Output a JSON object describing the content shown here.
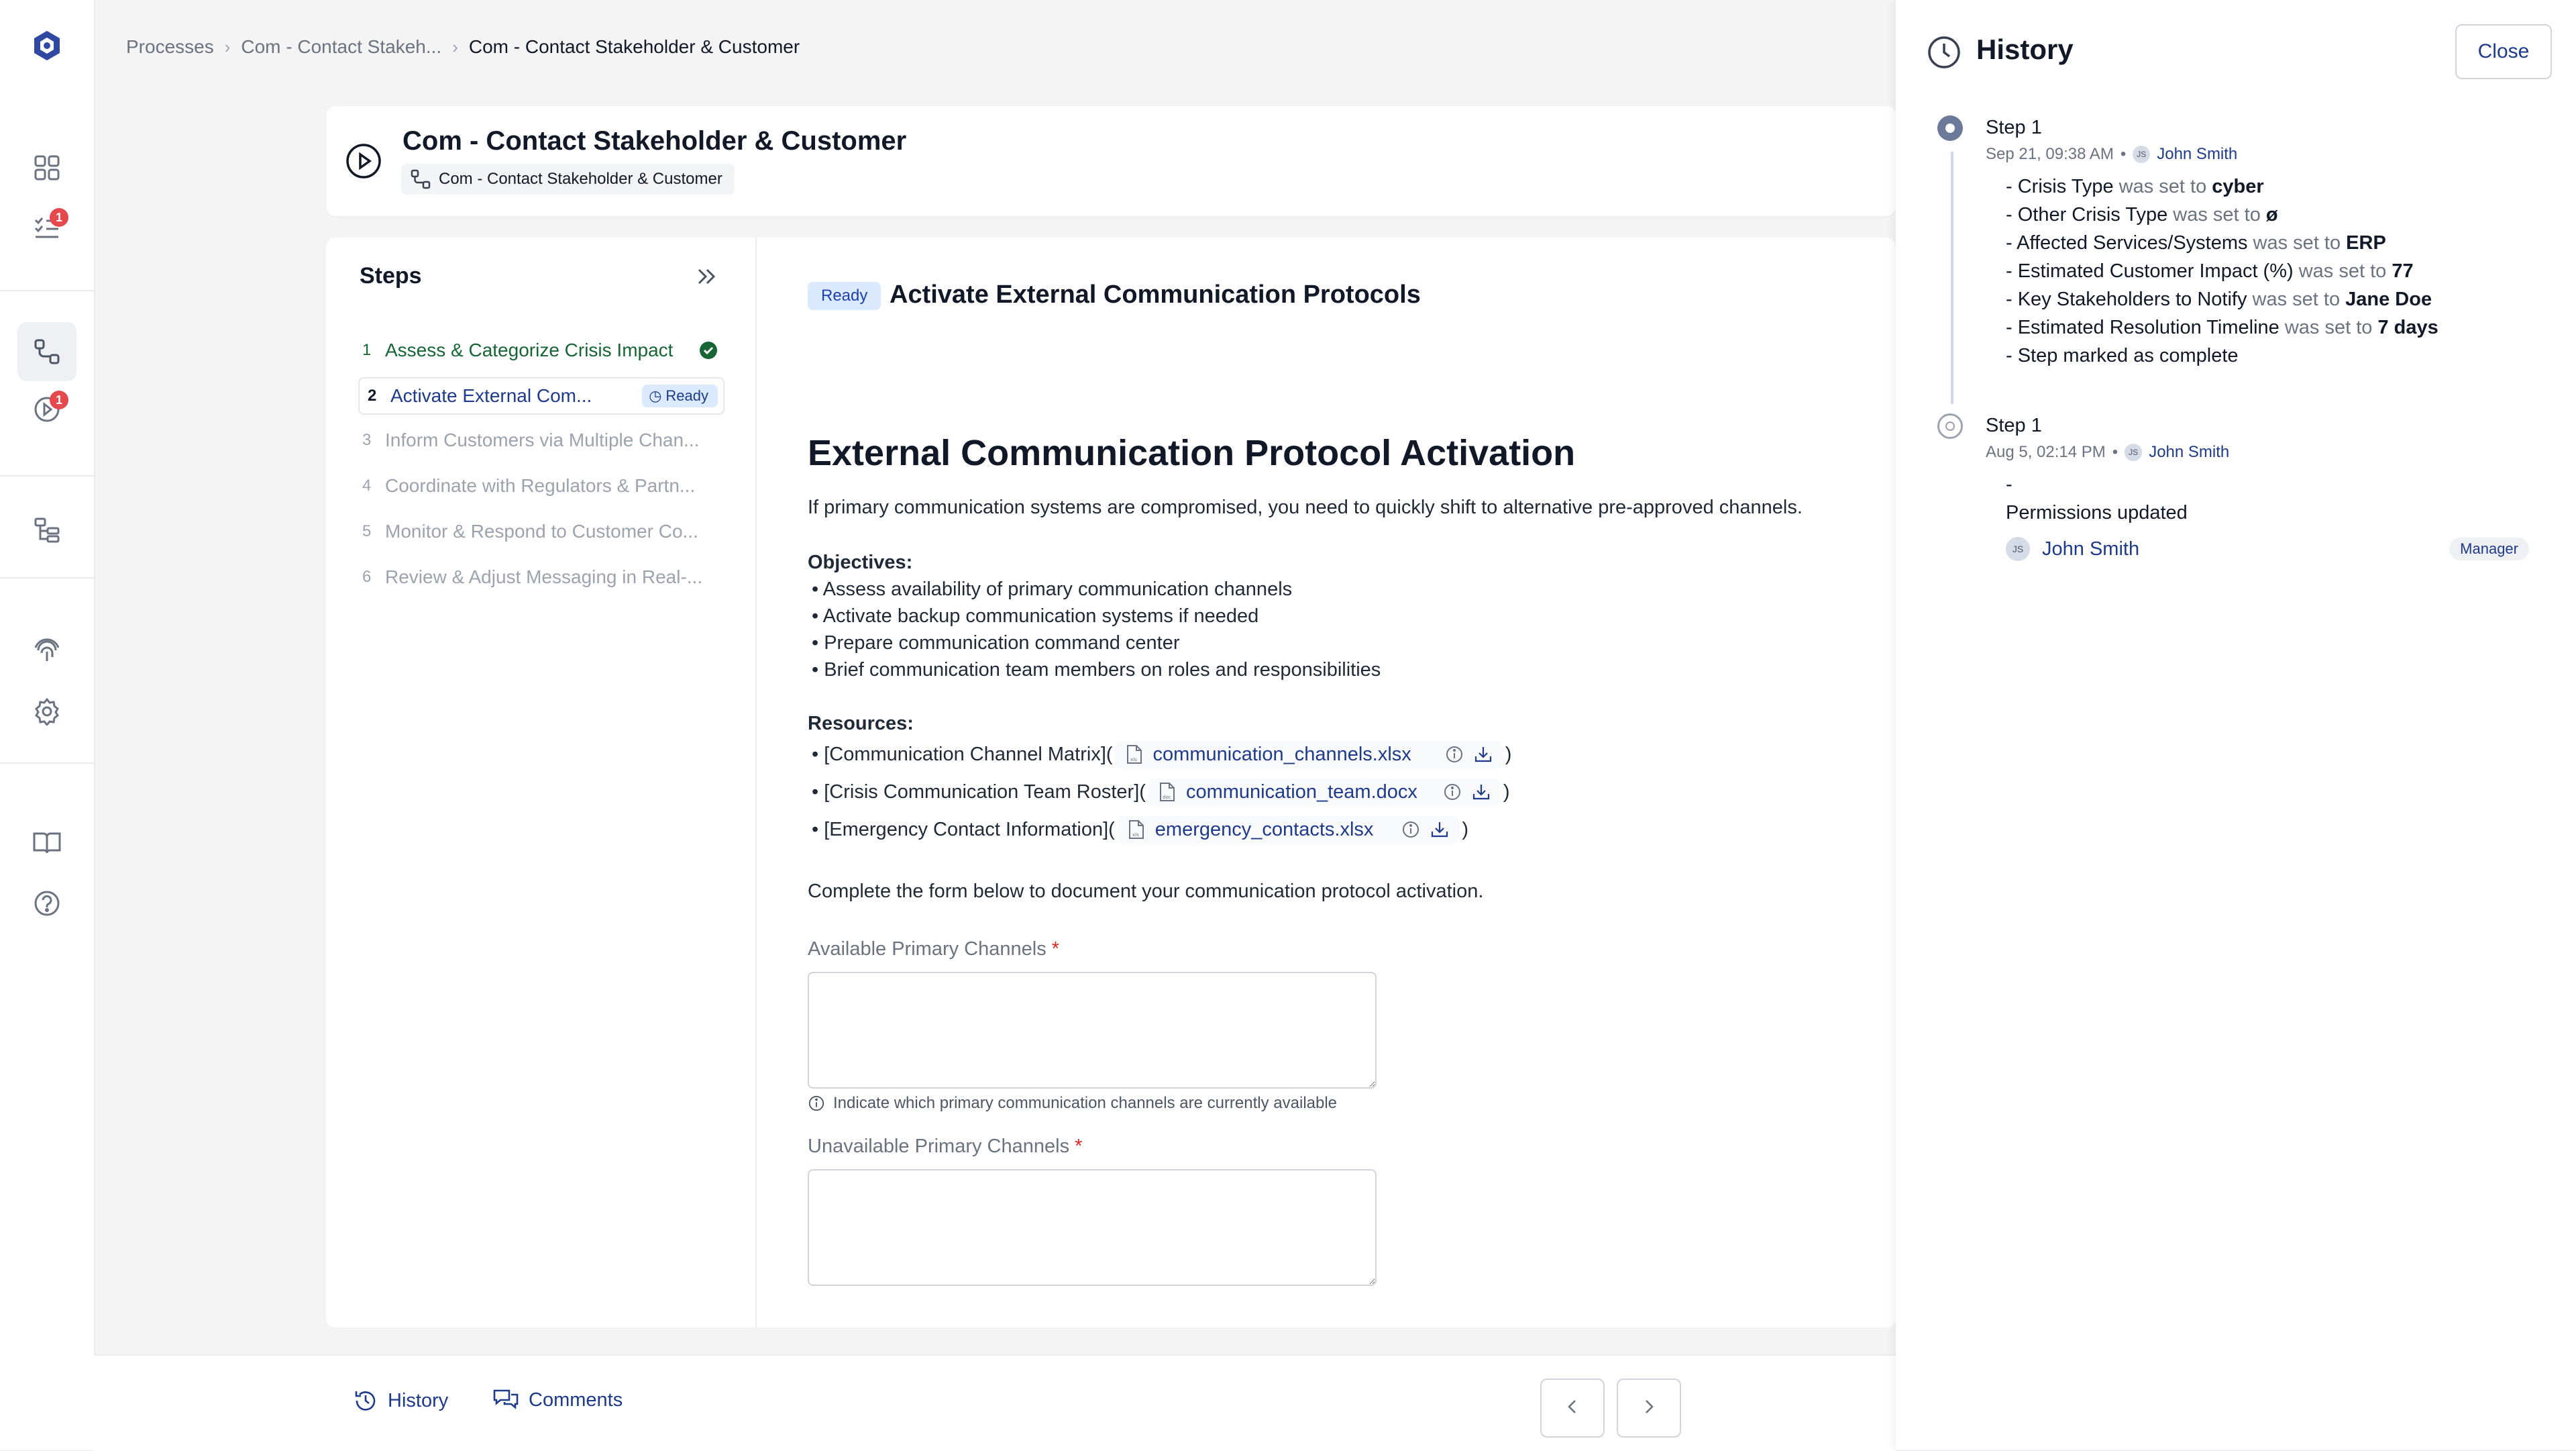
{
  "breadcrumb": {
    "root": "Processes",
    "parent": "Com - Contact Stakeh...",
    "current": "Com - Contact Stakeholder & Customer"
  },
  "header": {
    "title": "Com - Contact Stakeholder & Customer",
    "chip": "Com - Contact Stakeholder & Customer"
  },
  "rail": {
    "badge1": "1",
    "badge2": "1"
  },
  "steps": {
    "title": "Steps",
    "items": [
      {
        "num": "1",
        "label": "Assess & Categorize Crisis Impact"
      },
      {
        "num": "2",
        "label": "Activate External Com...",
        "badge": "Ready"
      },
      {
        "num": "3",
        "label": "Inform Customers via Multiple Chan..."
      },
      {
        "num": "4",
        "label": "Coordinate with Regulators & Partn..."
      },
      {
        "num": "5",
        "label": "Monitor & Respond to Customer Co..."
      },
      {
        "num": "6",
        "label": "Review & Adjust Messaging in Real-..."
      }
    ]
  },
  "content": {
    "status": "Ready",
    "title": "Activate External Communication Protocols",
    "heading": "External Communication Protocol Activation",
    "intro": "If primary communication systems are compromised, you need to quickly shift to alternative pre-approved channels.",
    "objectives_label": "Objectives:",
    "objectives": [
      "Assess availability of primary communication channels",
      "Activate backup communication systems if needed",
      "Prepare communication command center",
      "Brief communication team members on roles and responsibilities"
    ],
    "resources_label": "Resources:",
    "resources": [
      {
        "label": "[Communication Channel Matrix](",
        "file": "communication_channels.xlsx",
        "close": ")"
      },
      {
        "label": "[Crisis Communication Team Roster](",
        "file": "communication_team.docx",
        "close": ")"
      },
      {
        "label": "[Emergency Contact Information](",
        "file": "emergency_contacts.xlsx",
        "close": ")"
      }
    ],
    "form_intro": "Complete the form below to document your communication protocol activation.",
    "field1": {
      "label": "Available Primary Channels",
      "required": "*",
      "value": "",
      "hint": "Indicate which primary communication channels are currently available"
    },
    "field2": {
      "label": "Unavailable Primary Channels",
      "required": "*",
      "value": ""
    }
  },
  "bottom": {
    "history": "History",
    "comments": "Comments"
  },
  "history": {
    "title": "History",
    "close": "Close",
    "entries": [
      {
        "step": "Step 1",
        "date": "Sep 21, 09:38 AM",
        "dot": "•",
        "avatar": "JS",
        "user": "John Smith",
        "changes": [
          {
            "prefix": "- ",
            "field": "Crisis Type",
            "verb": " was set to ",
            "value": "cyber"
          },
          {
            "prefix": "- ",
            "field": "Other Crisis Type",
            "verb": " was set to ",
            "value": "ø"
          },
          {
            "prefix": "- ",
            "field": "Affected Services/Systems",
            "verb": " was set to ",
            "value": "ERP"
          },
          {
            "prefix": "- ",
            "field": "Estimated Customer Impact (%)",
            "verb": " was set to ",
            "value": "77"
          },
          {
            "prefix": "- ",
            "field": "Key Stakeholders to Notify",
            "verb": " was set to ",
            "value": "Jane Doe"
          },
          {
            "prefix": "- ",
            "field": "Estimated Resolution Timeline",
            "verb": " was set to ",
            "value": "7 days"
          },
          {
            "prefix": "- ",
            "field": "Step marked as complete",
            "verb": "",
            "value": ""
          }
        ]
      },
      {
        "step": "Step 1",
        "date": "Aug 5, 02:14 PM",
        "dot": "•",
        "avatar": "JS",
        "user": "John Smith",
        "dash": "-",
        "note": "Permissions updated",
        "perm_avatar": "JS",
        "perm_user": "John Smith",
        "role": "Manager"
      }
    ]
  },
  "colors": {
    "accent": "#1e3a8a",
    "ready_bg": "#dbeafe",
    "done": "#166534",
    "danger": "#e5484d"
  }
}
